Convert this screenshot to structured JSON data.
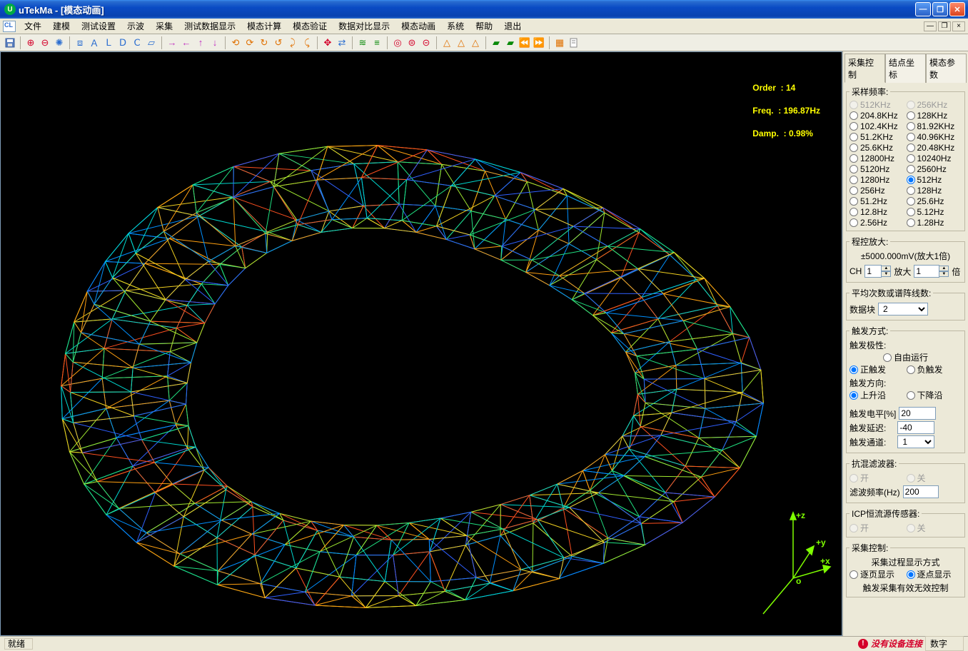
{
  "title": "uTekMa - [模态动画]",
  "menus": [
    "文件",
    "建模",
    "测试设置",
    "示波",
    "采集",
    "测试数据显示",
    "模态计算",
    "模态验证",
    "数据对比显示",
    "模态动画",
    "系统",
    "帮助",
    "退出"
  ],
  "overlay": {
    "order_label": "Order  :",
    "order_value": "14",
    "freq_label": "Freq.  :",
    "freq_value": "196.87Hz",
    "damp_label": "Damp.  :",
    "damp_value": "0.98%"
  },
  "axis": {
    "x": "+x",
    "y": "+y",
    "z": "+z",
    "o": "o"
  },
  "sidepanel": {
    "tabs": [
      "采集控制",
      "结点坐标",
      "模态参数"
    ],
    "sample_rate": {
      "title": "采样频率:",
      "options": [
        {
          "label": "512KHz",
          "disabled": true
        },
        {
          "label": "256KHz",
          "disabled": true
        },
        {
          "label": "204.8KHz"
        },
        {
          "label": "128KHz"
        },
        {
          "label": "102.4KHz"
        },
        {
          "label": "81.92KHz"
        },
        {
          "label": "51.2KHz"
        },
        {
          "label": "40.96KHz"
        },
        {
          "label": "25.6KHz"
        },
        {
          "label": "20.48KHz"
        },
        {
          "label": "12800Hz"
        },
        {
          "label": "10240Hz"
        },
        {
          "label": "5120Hz"
        },
        {
          "label": "2560Hz"
        },
        {
          "label": "1280Hz"
        },
        {
          "label": "512Hz",
          "checked": true
        },
        {
          "label": "256Hz"
        },
        {
          "label": "128Hz"
        },
        {
          "label": "51.2Hz"
        },
        {
          "label": "25.6Hz"
        },
        {
          "label": "12.8Hz"
        },
        {
          "label": "5.12Hz"
        },
        {
          "label": "2.56Hz"
        },
        {
          "label": "1.28Hz"
        }
      ]
    },
    "amp": {
      "title": "程控放大:",
      "subtitle": "±5000.000mV(放大1倍)",
      "ch_label": "CH",
      "ch_value": "1",
      "gain_label": "放大",
      "gain_value": "1",
      "gain_unit": "倍"
    },
    "avg": {
      "title": "平均次数或谱阵线数:",
      "label": "数据块",
      "value": "2"
    },
    "trigger": {
      "title": "触发方式:",
      "polarity_label": "触发极性:",
      "free": "自由运行",
      "pos": "正触发",
      "neg": "负触发",
      "dir_label": "触发方向:",
      "rise": "上升沿",
      "fall": "下降沿",
      "level_label": "触发电平[%]",
      "level_value": "20",
      "delay_label": "触发延迟:",
      "delay_value": "-40",
      "chan_label": "触发通道:",
      "chan_value": "1"
    },
    "aa": {
      "title": "抗混滤波器:",
      "open": "开",
      "close": "关",
      "freq_label": "滤波频率(Hz)",
      "freq_value": "200"
    },
    "icp": {
      "title": "ICP恒流源传感器:",
      "open": "开",
      "close": "关"
    },
    "acq": {
      "title": "采集控制:",
      "disp_label": "采集过程显示方式",
      "page": "逐页显示",
      "point": "逐点显示",
      "valid_label": "触发采集有效无效控制"
    }
  },
  "status": {
    "ready": "就绪",
    "warn": "没有设备连接",
    "end": "数字"
  }
}
